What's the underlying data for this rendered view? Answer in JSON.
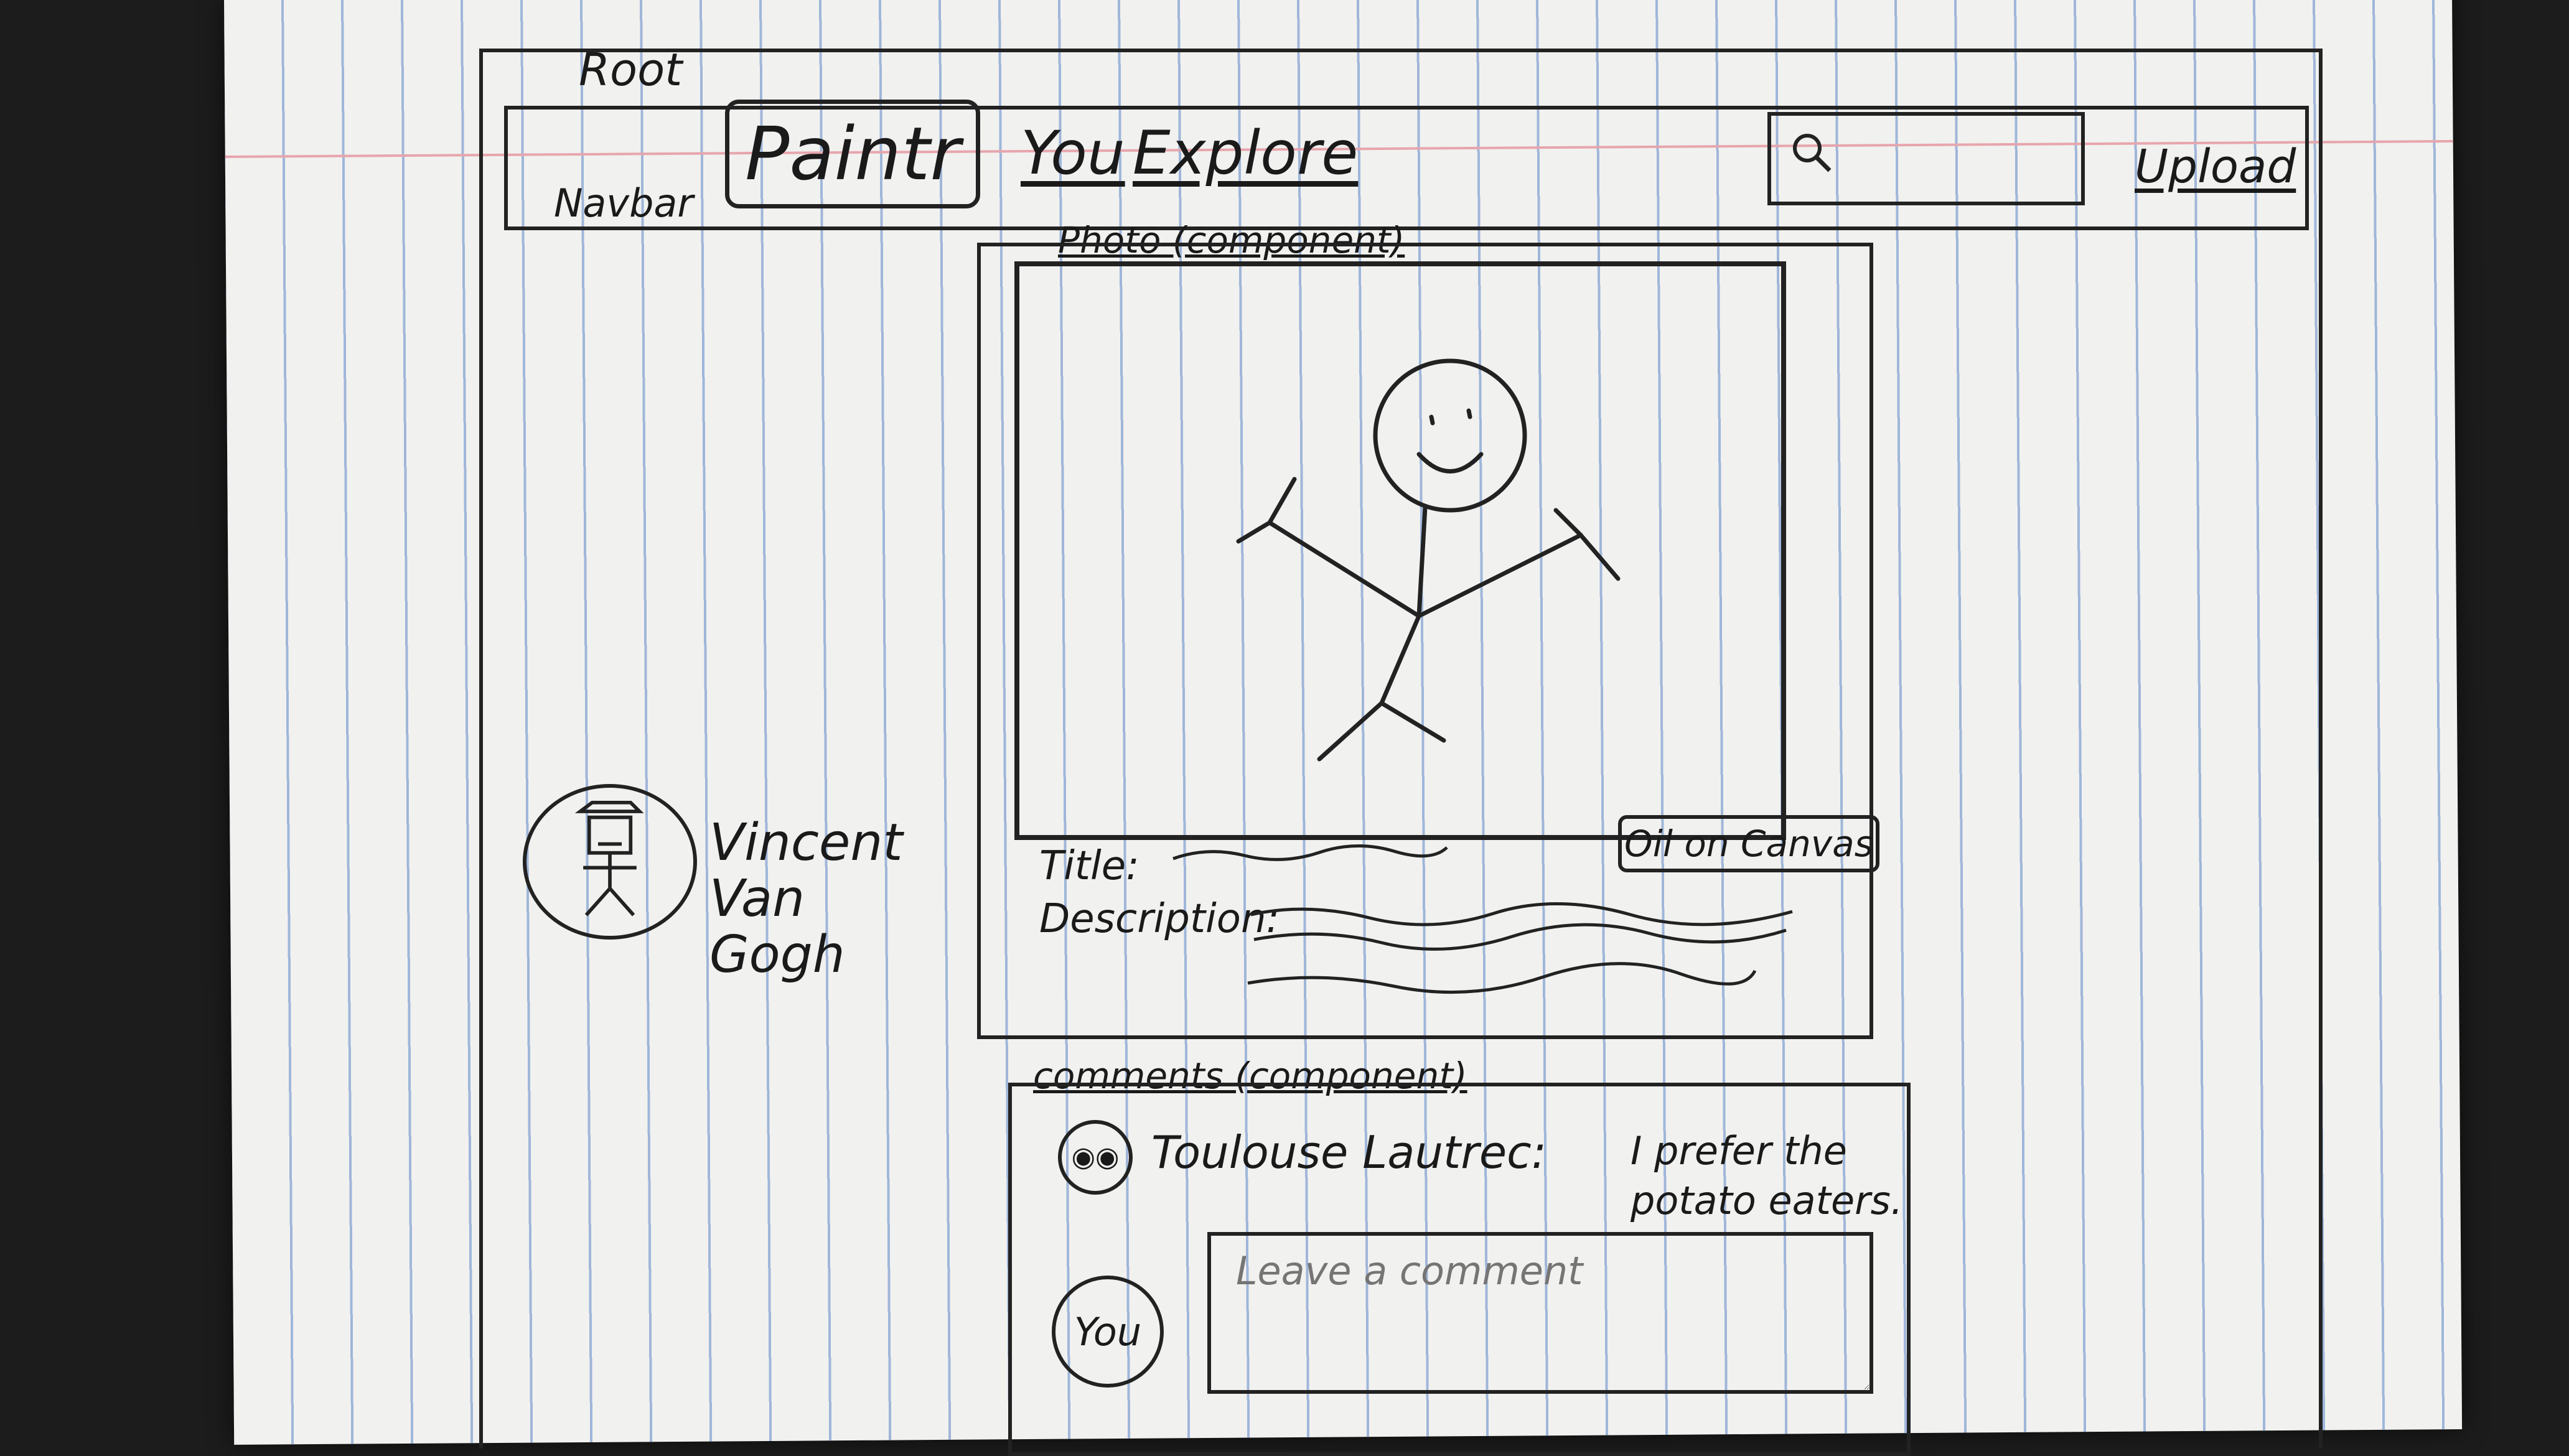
{
  "root": {
    "label": "Root"
  },
  "navbar": {
    "label": "Navbar",
    "brand": "Paintr",
    "links": [
      "You",
      "Explore"
    ],
    "upload": "Upload"
  },
  "photo": {
    "label": "Photo (component)",
    "medium": "Oil on Canvas",
    "title_label": "Title:",
    "description_label": "Description:"
  },
  "artist": {
    "name": "Vincent Van Gogh"
  },
  "comments": {
    "label": "comments (component)",
    "items": [
      {
        "author": "Toulouse Lautrec:",
        "text": "I prefer the potato eaters."
      }
    ],
    "you_label": "You",
    "input_placeholder": "Leave a comment"
  }
}
